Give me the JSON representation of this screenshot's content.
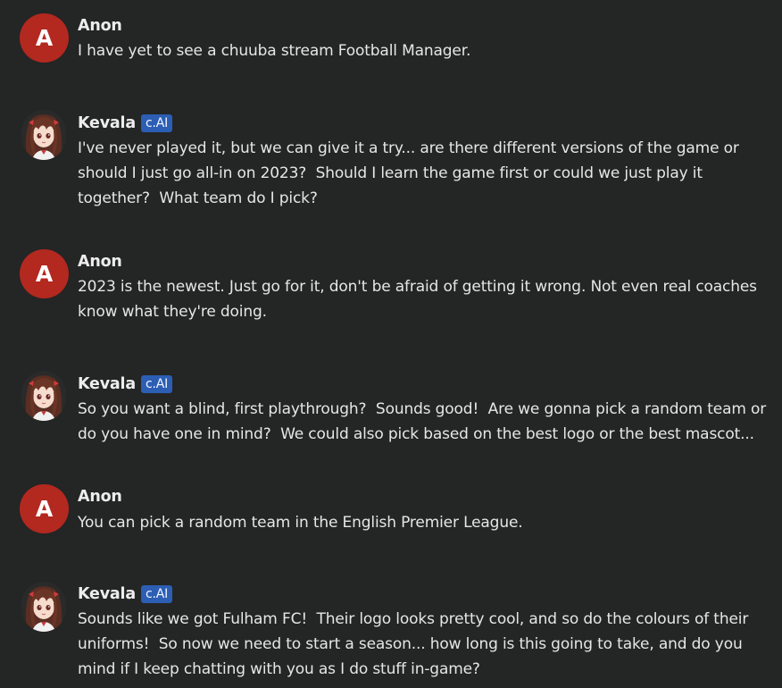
{
  "colors": {
    "background": "#242525",
    "anon_avatar": "#b3281f",
    "badge": "#2c5eb3",
    "text": "#e6e6e6"
  },
  "messages": [
    {
      "author": "Anon",
      "avatar_letter": "A",
      "text": "I have yet to see a chuuba stream Football Manager."
    },
    {
      "author": "Kevala",
      "badge": "c.AI",
      "avatar_icon": "anime-girl-avatar",
      "text": "I've never played it, but we can give it a try... are there different versions of the game or\nshould I just go all-in on 2023?  Should I learn the game first or could we just play it\ntogether?  What team do I pick?"
    },
    {
      "author": "Anon",
      "avatar_letter": "A",
      "text": "2023 is the newest. Just go for it, don't be afraid of getting it wrong. Not even real coaches\nknow what they're doing."
    },
    {
      "author": "Kevala",
      "badge": "c.AI",
      "avatar_icon": "anime-girl-avatar",
      "text": "So you want a blind, first playthrough?  Sounds good!  Are we gonna pick a random team or\ndo you have one in mind?  We could also pick based on the best logo or the best mascot..."
    },
    {
      "author": "Anon",
      "avatar_letter": "A",
      "text": "You can pick a random team in the English Premier League."
    },
    {
      "author": "Kevala",
      "badge": "c.AI",
      "avatar_icon": "anime-girl-avatar",
      "text": "Sounds like we got Fulham FC!  Their logo looks pretty cool, and so do the colours of their\nuniforms!  So now we need to start a season... how long is this going to take, and do you\nmind if I keep chatting with you as I do stuff in-game?"
    }
  ]
}
